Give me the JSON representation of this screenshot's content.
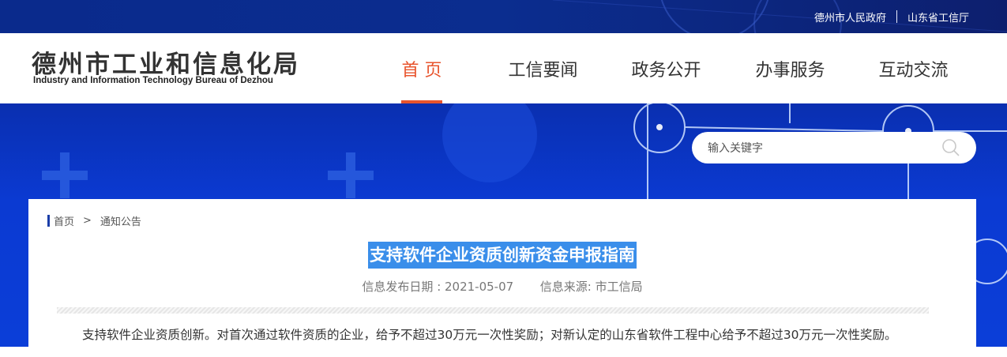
{
  "topbar": {
    "links": [
      "德州市人民政府",
      "山东省工信厅"
    ]
  },
  "header": {
    "logo_cn": "德州市工业和信息化局",
    "logo_en": "Industry and Information Technology Bureau of Dezhou"
  },
  "nav": {
    "items": [
      {
        "label": "首 页",
        "active": true
      },
      {
        "label": "工信要闻",
        "active": false
      },
      {
        "label": "政务公开",
        "active": false
      },
      {
        "label": "办事服务",
        "active": false
      },
      {
        "label": "互动交流",
        "active": false
      }
    ]
  },
  "search": {
    "placeholder": "输入关键字",
    "icon": "search-icon"
  },
  "breadcrumb": {
    "home": "首页",
    "separator": ">",
    "current": "通知公告"
  },
  "article": {
    "title": "支持软件企业资质创新资金申报指南",
    "publish_date": "信息发布日期 : 2021-05-07",
    "source": "信息来源: 市工信局",
    "paragraph": "支持软件企业资质创新。对首次通过软件资质的企业，给予不超过30万元一次性奖励；对新认定的山东省软件工程中心给予不超过30万元一次性奖励。"
  },
  "colors": {
    "accent": "#e8542d",
    "banner_blue": "#0b3ad2",
    "topbar_blue": "#0a2a8c",
    "title_highlight": "#3a8eea"
  }
}
